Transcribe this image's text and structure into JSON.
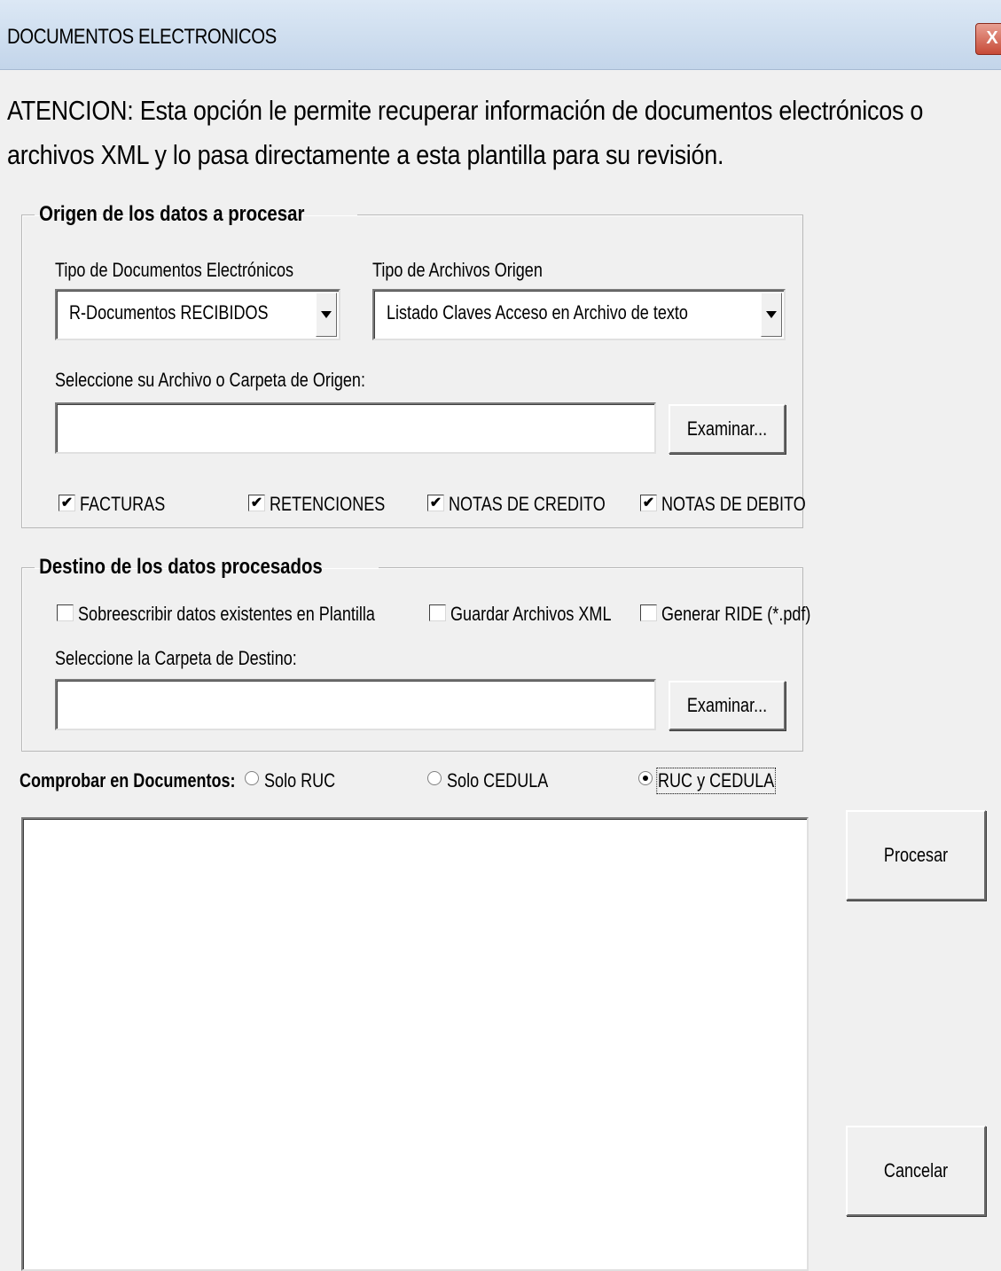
{
  "window": {
    "title": "DOCUMENTOS ELECTRONICOS",
    "close_label": "X"
  },
  "attention": "ATENCION: Esta opción le permite recuperar información de documentos electrónicos o archivos XML y lo pasa directamente a esta plantilla para su revisión.",
  "origin": {
    "legend": "Origen de los datos a procesar",
    "doc_type_label": "Tipo de Documentos Electrónicos",
    "doc_type_value": "R-Documentos RECIBIDOS",
    "file_type_label": "Tipo de Archivos Origen",
    "file_type_value": "Listado Claves Acceso en Archivo de texto",
    "select_label": "Seleccione su Archivo o Carpeta de Origen:",
    "path_value": "",
    "browse_label": "Examinar...",
    "checks": [
      {
        "label": "FACTURAS",
        "checked": true
      },
      {
        "label": "RETENCIONES",
        "checked": true
      },
      {
        "label": "NOTAS DE CREDITO",
        "checked": true
      },
      {
        "label": "NOTAS DE DEBITO",
        "checked": true
      }
    ]
  },
  "destination": {
    "legend": "Destino de los datos procesados",
    "checks": [
      {
        "label": "Sobreescribir datos existentes en Plantilla",
        "checked": false
      },
      {
        "label": "Guardar Archivos XML",
        "checked": false
      },
      {
        "label": "Generar RIDE (*.pdf)",
        "checked": false
      }
    ],
    "select_label": "Seleccione la Carpeta de Destino:",
    "path_value": "",
    "browse_label": "Examinar..."
  },
  "verify": {
    "label": "Comprobar en Documentos:",
    "options": [
      {
        "label": "Solo RUC",
        "selected": false
      },
      {
        "label": "Solo CEDULA",
        "selected": false
      },
      {
        "label": "RUC y CEDULA",
        "selected": true
      }
    ]
  },
  "buttons": {
    "process": "Procesar",
    "cancel": "Cancelar"
  }
}
